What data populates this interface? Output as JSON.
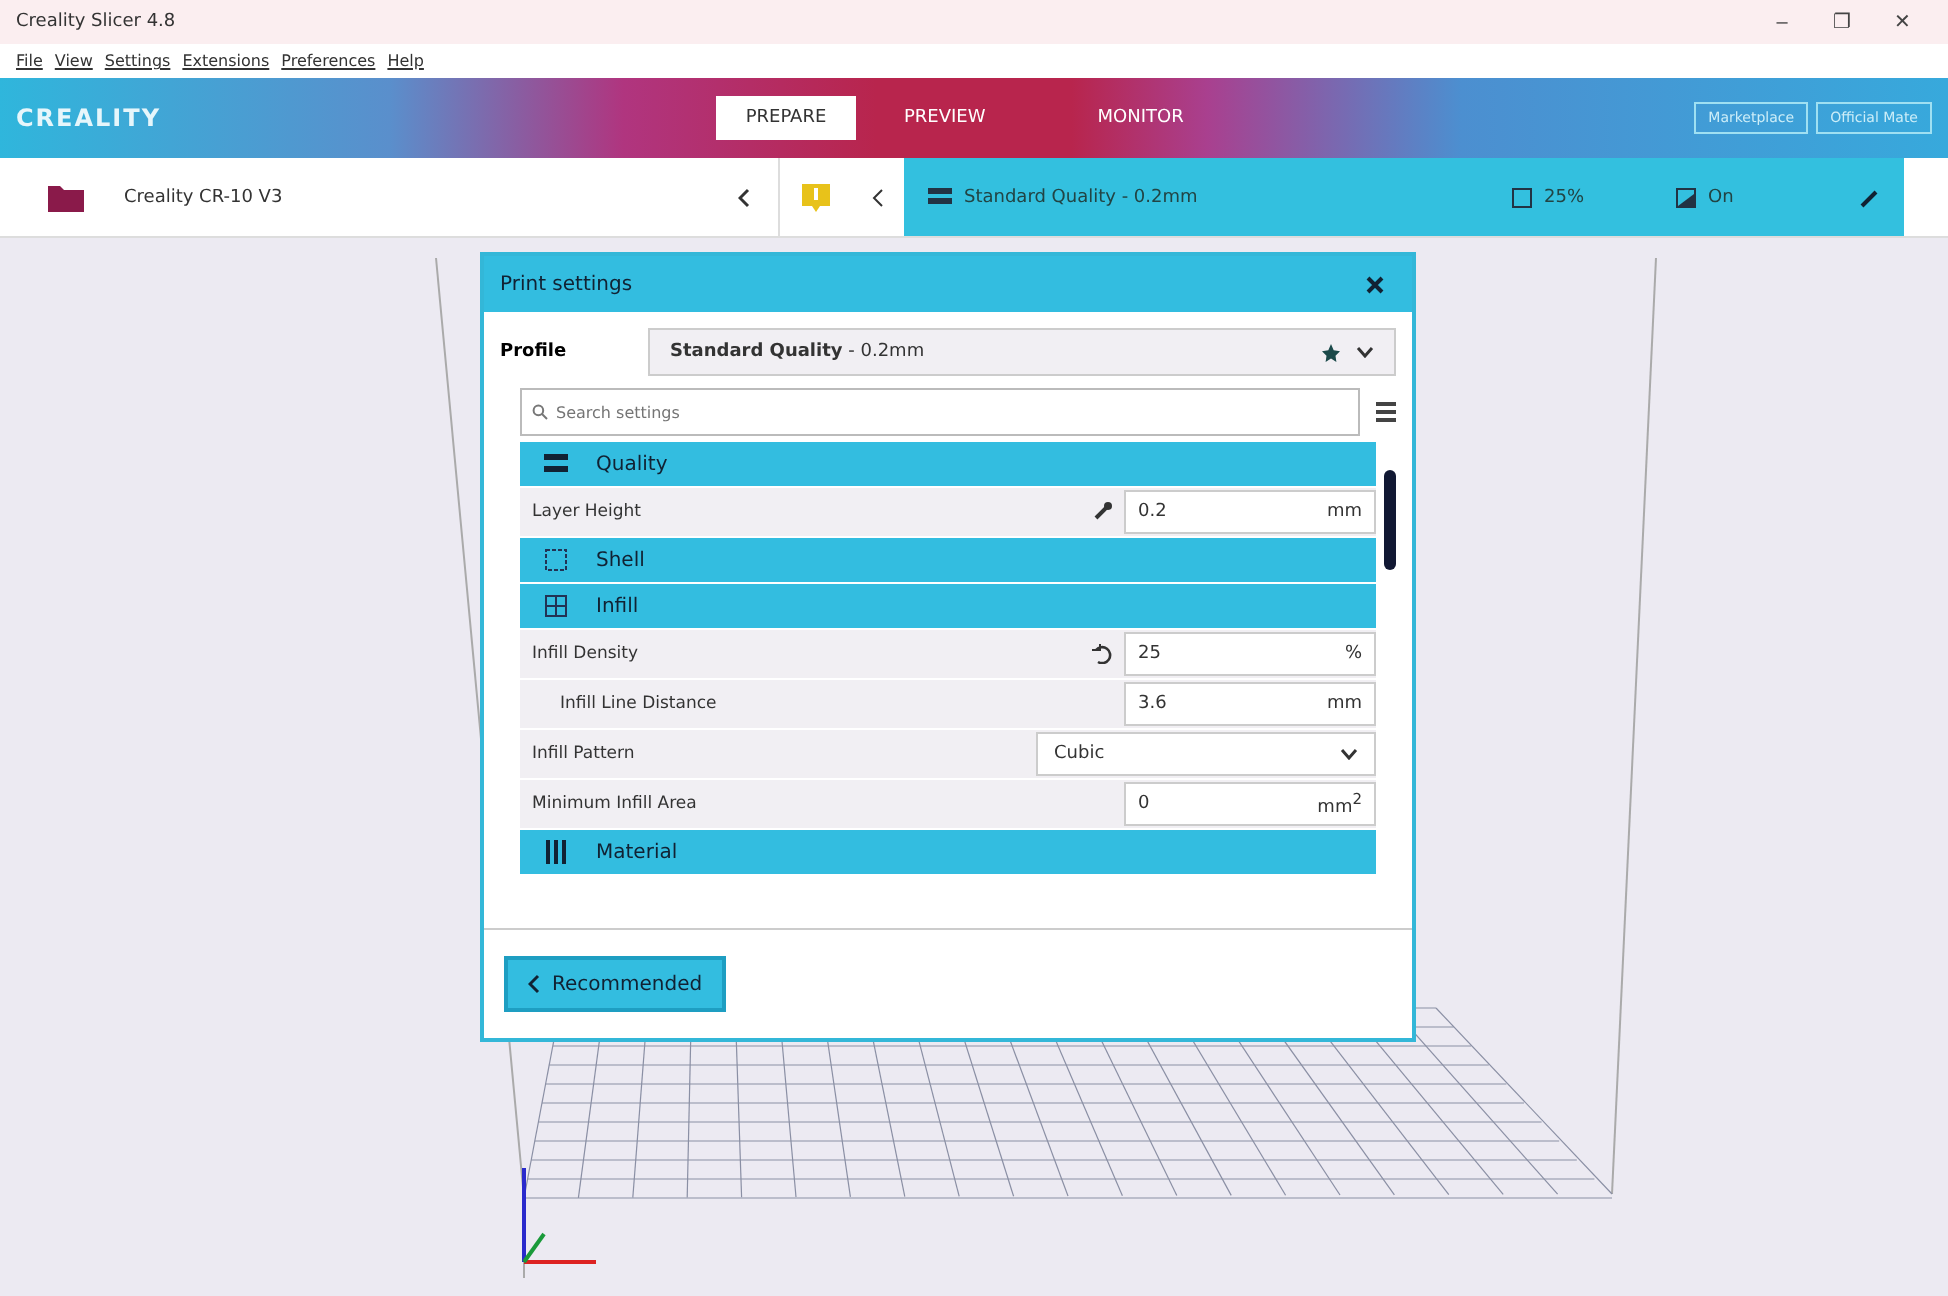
{
  "window": {
    "title": "Creality Slicer 4.8",
    "controls": [
      "–",
      "❐",
      "✕"
    ]
  },
  "menu": [
    "File",
    "View",
    "Settings",
    "Extensions",
    "Preferences",
    "Help"
  ],
  "header": {
    "logo": "CREALITY",
    "tabs": [
      {
        "label": "PREPARE",
        "selected": true
      },
      {
        "label": "PREVIEW",
        "selected": false
      },
      {
        "label": "MONITOR",
        "selected": false
      }
    ],
    "buttons": [
      "Marketplace",
      "Official Mate"
    ]
  },
  "toolbar": {
    "printer": "Creality CR-10 V3",
    "profile": "Standard Quality - 0.2mm",
    "infill": "25%",
    "support": "On"
  },
  "dialog": {
    "title": "Print settings",
    "profile_label": "Profile",
    "profile": "**Standard Quality** - 0.2mm",
    "search": {
      "placeholder": "Search settings"
    },
    "rows": [
      {
        "kind": "category",
        "label": "Quality"
      },
      {
        "kind": "number",
        "label": "Layer Height",
        "linked": true,
        "modified": false,
        "value": "0.2",
        "unit": "mm"
      },
      {
        "kind": "category",
        "label": "Shell"
      },
      {
        "kind": "category",
        "label": "Infill"
      },
      {
        "kind": "number",
        "label": "Infill Density",
        "linked": false,
        "modified": true,
        "value": "25",
        "unit": "%",
        "children": [
          {
            "kind": "number",
            "label": "Infill Line Distance",
            "linked": false,
            "modified": false,
            "value": "3.6",
            "unit": "mm"
          }
        ]
      },
      {
        "kind": "dropdown",
        "label": "Infill Pattern",
        "linked": false,
        "modified": false,
        "value": "Cubic"
      },
      {
        "kind": "number",
        "label": "Minimum Infill Area",
        "linked": false,
        "modified": false,
        "value": "0",
        "unit": "mm$^{2}$"
      },
      {
        "kind": "category",
        "label": "Material"
      }
    ],
    "back_button": "Recommended"
  }
}
